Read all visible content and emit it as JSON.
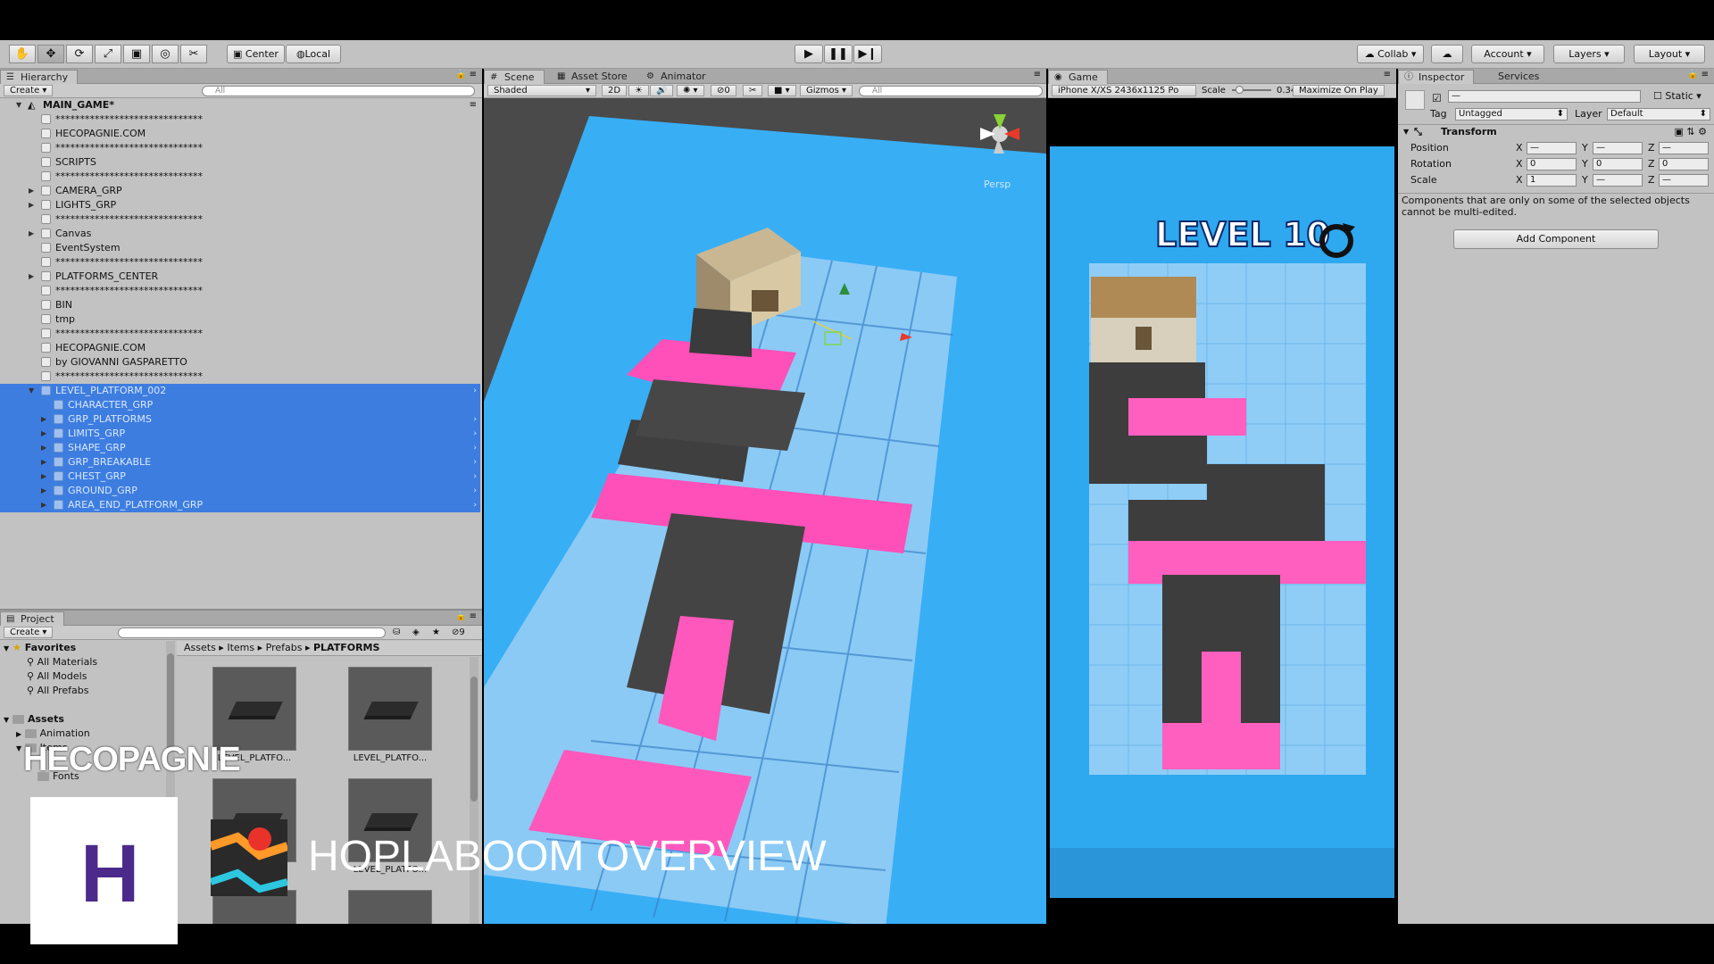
{
  "toolbar": {
    "pivot_center": "Center",
    "pivot_local": "Local",
    "collab": "Collab",
    "account": "Account",
    "layers": "Layers",
    "layout": "Layout"
  },
  "hierarchy": {
    "tab": "Hierarchy",
    "create": "Create",
    "search_placeholder": "All",
    "scene_name": "MAIN_GAME*",
    "items": [
      {
        "label": "******************************",
        "depth": 1,
        "has_arrow": false
      },
      {
        "label": "HECOPAGNIE.COM",
        "depth": 1,
        "has_arrow": false
      },
      {
        "label": "******************************",
        "depth": 1,
        "has_arrow": false
      },
      {
        "label": "SCRIPTS",
        "depth": 1,
        "has_arrow": false
      },
      {
        "label": "******************************",
        "depth": 1,
        "has_arrow": false
      },
      {
        "label": "CAMERA_GRP",
        "depth": 1,
        "has_arrow": true
      },
      {
        "label": "LIGHTS_GRP",
        "depth": 1,
        "has_arrow": true
      },
      {
        "label": "******************************",
        "depth": 1,
        "has_arrow": false
      },
      {
        "label": "Canvas",
        "depth": 1,
        "has_arrow": true
      },
      {
        "label": "EventSystem",
        "depth": 1,
        "has_arrow": false
      },
      {
        "label": "******************************",
        "depth": 1,
        "has_arrow": false
      },
      {
        "label": "PLATFORMS_CENTER",
        "depth": 1,
        "has_arrow": true
      },
      {
        "label": "******************************",
        "depth": 1,
        "has_arrow": false
      },
      {
        "label": "BIN",
        "depth": 1,
        "has_arrow": false
      },
      {
        "label": "tmp",
        "depth": 1,
        "has_arrow": false
      },
      {
        "label": "******************************",
        "depth": 1,
        "has_arrow": false
      },
      {
        "label": "HECOPAGNIE.COM",
        "depth": 1,
        "has_arrow": false
      },
      {
        "label": "by GIOVANNI GASPARETTO",
        "depth": 1,
        "has_arrow": false
      },
      {
        "label": "******************************",
        "depth": 1,
        "has_arrow": false
      },
      {
        "label": "LEVEL_PLATFORM_002",
        "depth": 1,
        "has_arrow": true,
        "selected": true,
        "expanded": true
      },
      {
        "label": "CHARACTER_GRP",
        "depth": 2,
        "has_arrow": false,
        "selected": true
      },
      {
        "label": "GRP_PLATFORMS",
        "depth": 2,
        "has_arrow": true,
        "selected": true
      },
      {
        "label": "LIMITS_GRP",
        "depth": 2,
        "has_arrow": true,
        "selected": true
      },
      {
        "label": "SHAPE_GRP",
        "depth": 2,
        "has_arrow": true,
        "selected": true
      },
      {
        "label": "GRP_BREAKABLE",
        "depth": 2,
        "has_arrow": true,
        "selected": true
      },
      {
        "label": "CHEST_GRP",
        "depth": 2,
        "has_arrow": true,
        "selected": true
      },
      {
        "label": "GROUND_GRP",
        "depth": 2,
        "has_arrow": true,
        "selected": true
      },
      {
        "label": "AREA_END_PLATFORM_GRP",
        "depth": 2,
        "has_arrow": true,
        "selected": true
      }
    ]
  },
  "project": {
    "tab": "Project",
    "create": "Create",
    "filter_count": "9",
    "favorites": {
      "label": "Favorites",
      "items": [
        "All Materials",
        "All Models",
        "All Prefabs"
      ]
    },
    "assets": {
      "label": "Assets",
      "items": [
        "Animation",
        "Items",
        "Fonts"
      ]
    },
    "breadcrumb": [
      "Assets",
      "Items",
      "Prefabs",
      "PLATFORMS"
    ],
    "thumb_labels": [
      "LEVEL_PLATFO...",
      "LEVEL_PLATFO...",
      "LEVEL_PLATFO..."
    ]
  },
  "scene": {
    "tabs": [
      "Scene",
      "Asset Store",
      "Animator"
    ],
    "shading": "Shaded",
    "mode_2d": "2D",
    "fx_count": "0",
    "gizmos": "Gizmos",
    "search_placeholder": "All",
    "persp": "Persp"
  },
  "game": {
    "tab": "Game",
    "resolution": "iPhone X/XS 2436x1125 Po",
    "scale_label": "Scale",
    "scale_value": "0.34",
    "maximize": "Maximize On Play",
    "level_title": "LEVEL 10"
  },
  "inspector": {
    "tabs": [
      "Inspector",
      "Services"
    ],
    "name_value": "—",
    "static_label": "Static",
    "tag_label": "Tag",
    "tag_value": "Untagged",
    "layer_label": "Layer",
    "layer_value": "Default",
    "transform_title": "Transform",
    "position_label": "Position",
    "rotation_label": "Rotation",
    "scale_label": "Scale",
    "position": {
      "x": "—",
      "y": "—",
      "z": "—"
    },
    "rotation": {
      "x": "0",
      "y": "0",
      "z": "0"
    },
    "scale": {
      "x": "1",
      "y": "—",
      "z": "—"
    },
    "note": "Components that are only on some of the selected objects cannot be multi-edited.",
    "add_component": "Add Component"
  },
  "watermark": {
    "brand": "HECOPAGNIE",
    "logo_letter": "H",
    "title": "HOPLABOOM OVERVIEW"
  },
  "colors": {
    "selection": "#3e7de0",
    "panel": "#c2c2c2",
    "sky": "#35a8f3",
    "pink": "#ff5fbf",
    "block": "#404040"
  }
}
